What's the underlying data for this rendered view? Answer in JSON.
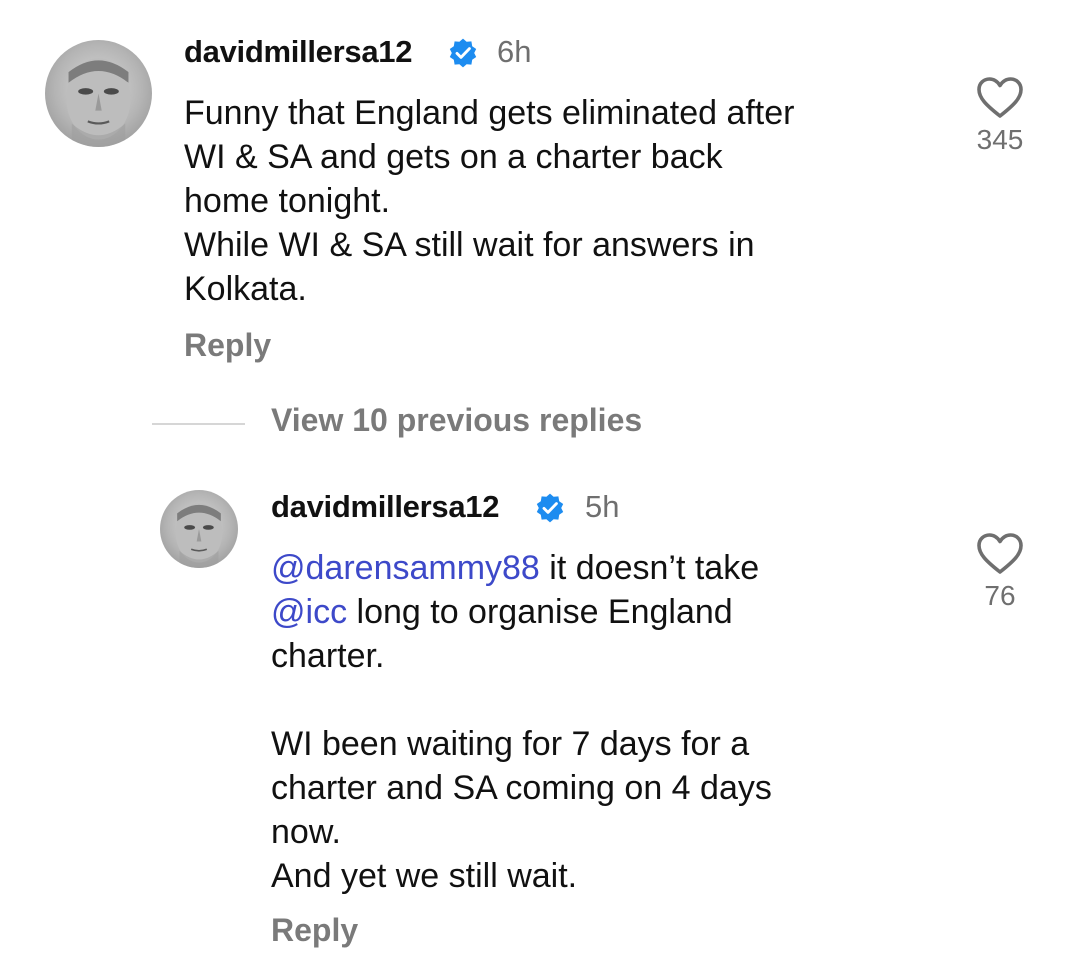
{
  "comments": [
    {
      "username": "davidmillersa12",
      "time": "6h",
      "lines": [
        "Funny that England gets eliminated after",
        "WI & SA and gets on a charter back",
        "home tonight.",
        "While WI & SA still wait for answers in",
        "Kolkata."
      ],
      "likes": "345",
      "reply_label": "Reply",
      "icons": {
        "avatar": "avatar",
        "verified": "verified-badge-icon",
        "like": "heart-icon"
      }
    }
  ],
  "view_replies_label": "View 10 previous replies",
  "replies": [
    {
      "username": "davidmillersa12",
      "time": "5h",
      "line1_mention": "@darensammy88",
      "line1_rest": " it doesn’t take",
      "line2_mention": "@icc",
      "line2_rest": " long to organise England",
      "lines_after": [
        "charter.",
        "",
        "WI been waiting for 7 days for a",
        "charter and SA coming on 4 days",
        "now.",
        "And yet we still wait."
      ],
      "likes": "76",
      "reply_label": "Reply"
    }
  ],
  "colors": {
    "mention": "#3d49c9",
    "verified": "#1d8cf0",
    "secondary_text": "#6f6f6f",
    "primary_text": "#111111"
  }
}
